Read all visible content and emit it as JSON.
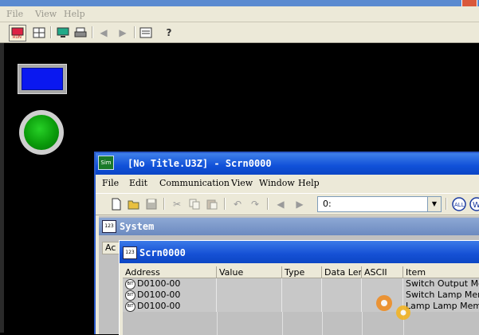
{
  "background_app": {
    "menu": [
      "File",
      "View",
      "Help"
    ],
    "toolbar_icons": [
      "run-icon",
      "grid-icon",
      "monitor-icon",
      "print-icon",
      "back-icon",
      "forward-icon",
      "screen-icon",
      "help-icon"
    ],
    "canvas_objects": [
      "blue-rectangle",
      "green-lamp"
    ],
    "colors": {
      "canvas": "#000000",
      "rect_fill": "#0a18f0",
      "lamp": "#0a9b0a"
    }
  },
  "sim_window": {
    "icon_text": "Sim",
    "title": "[No Title.U3Z] - Scrn0000",
    "menu": [
      "File",
      "Edit",
      "Communication",
      "View",
      "Window",
      "Help"
    ],
    "toolbar_icons": [
      "new-icon",
      "open-icon",
      "save-icon",
      "cut-icon",
      "copy-icon",
      "paste-icon",
      "undo-icon",
      "redo-icon",
      "prev-icon",
      "next-icon"
    ],
    "screen_select_value": "0:",
    "right_icons": [
      "all-icon",
      "w-icon"
    ]
  },
  "system_window": {
    "title": "System",
    "col_header": "Ac"
  },
  "scrn_window": {
    "icon_text": "123",
    "title": "Scrn0000",
    "columns": [
      "Address",
      "Value",
      "Type",
      "Data Len",
      "ASCII",
      "Item"
    ],
    "rows": [
      {
        "bit": "BIT",
        "address": "D0100-00",
        "value": "",
        "type": "",
        "data_len": "",
        "ascii": "",
        "item": "Switch Output Memory"
      },
      {
        "bit": "BIT",
        "address": "D0100-00",
        "value": "",
        "type": "",
        "data_len": "",
        "ascii": "",
        "item": "Switch Lamp Memory"
      },
      {
        "bit": "BIT",
        "address": "D0100-00",
        "value": "",
        "type": "",
        "data_len": "",
        "ascii": "",
        "item": "Lamp Lamp Memory"
      }
    ]
  }
}
